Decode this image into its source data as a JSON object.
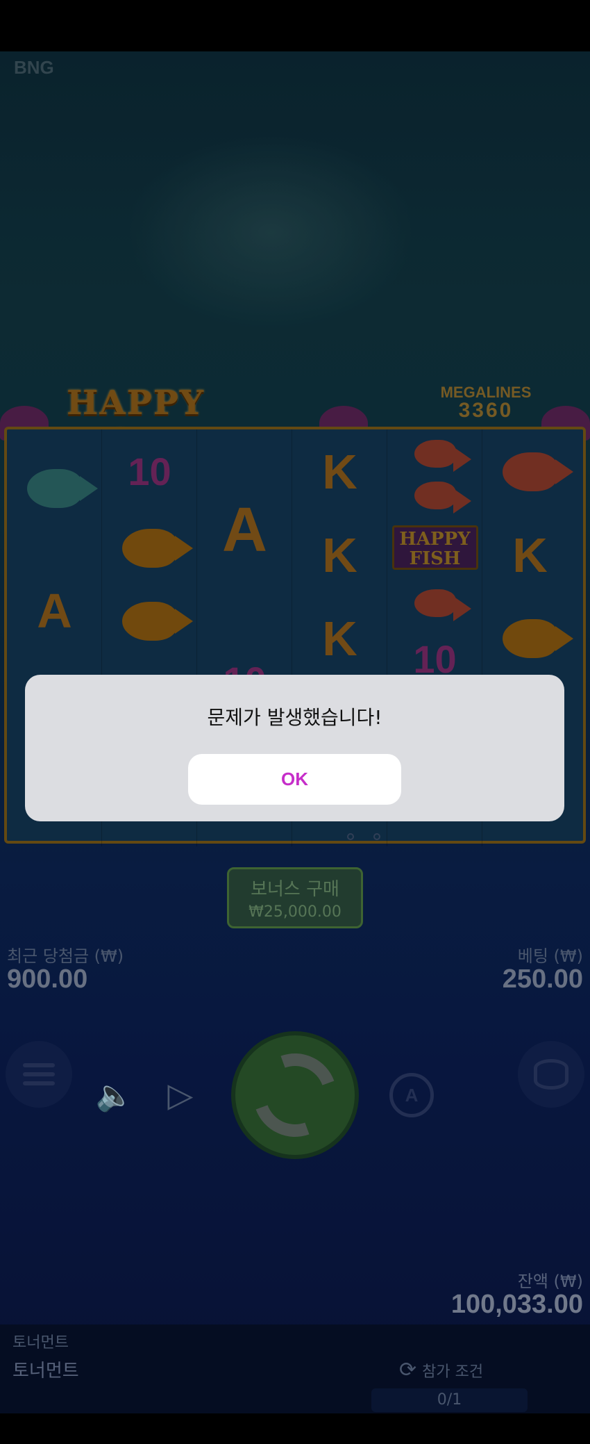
{
  "brand": "BNG",
  "game": {
    "logo_text": "HAPPY FISH",
    "megalines_label": "MEGALINES",
    "megalines_value": "3360"
  },
  "reels": [
    [
      "fish-teal",
      "A"
    ],
    [
      "10",
      "fish-gold",
      "fish-gold"
    ],
    [
      "A",
      "10"
    ],
    [
      "K",
      "K",
      "K"
    ],
    [
      "fish-red",
      "fish-red",
      "HAPPY FISH",
      "fish-red",
      "10"
    ],
    [
      "fish-red",
      "K",
      "fish-gold"
    ]
  ],
  "bonus_buy": {
    "label": "보너스 구매",
    "price": "₩25,000.00"
  },
  "last_win": {
    "label": "최근 당첨금 (₩)",
    "value": "900.00"
  },
  "bet": {
    "label": "베팅 (₩)",
    "value": "250.00"
  },
  "balance": {
    "label": "잔액 (₩)",
    "value": "100,033.00"
  },
  "auto_label": "A",
  "tournament": {
    "title_small": "토너먼트",
    "title": "토너먼트",
    "join_label": "참가 조건",
    "progress": "0/1"
  },
  "dialog": {
    "message": "문제가 발생했습니다!",
    "ok_label": "OK"
  },
  "colors": {
    "dialog_bg": "#dcdde1",
    "ok_text": "#c62ec9"
  }
}
